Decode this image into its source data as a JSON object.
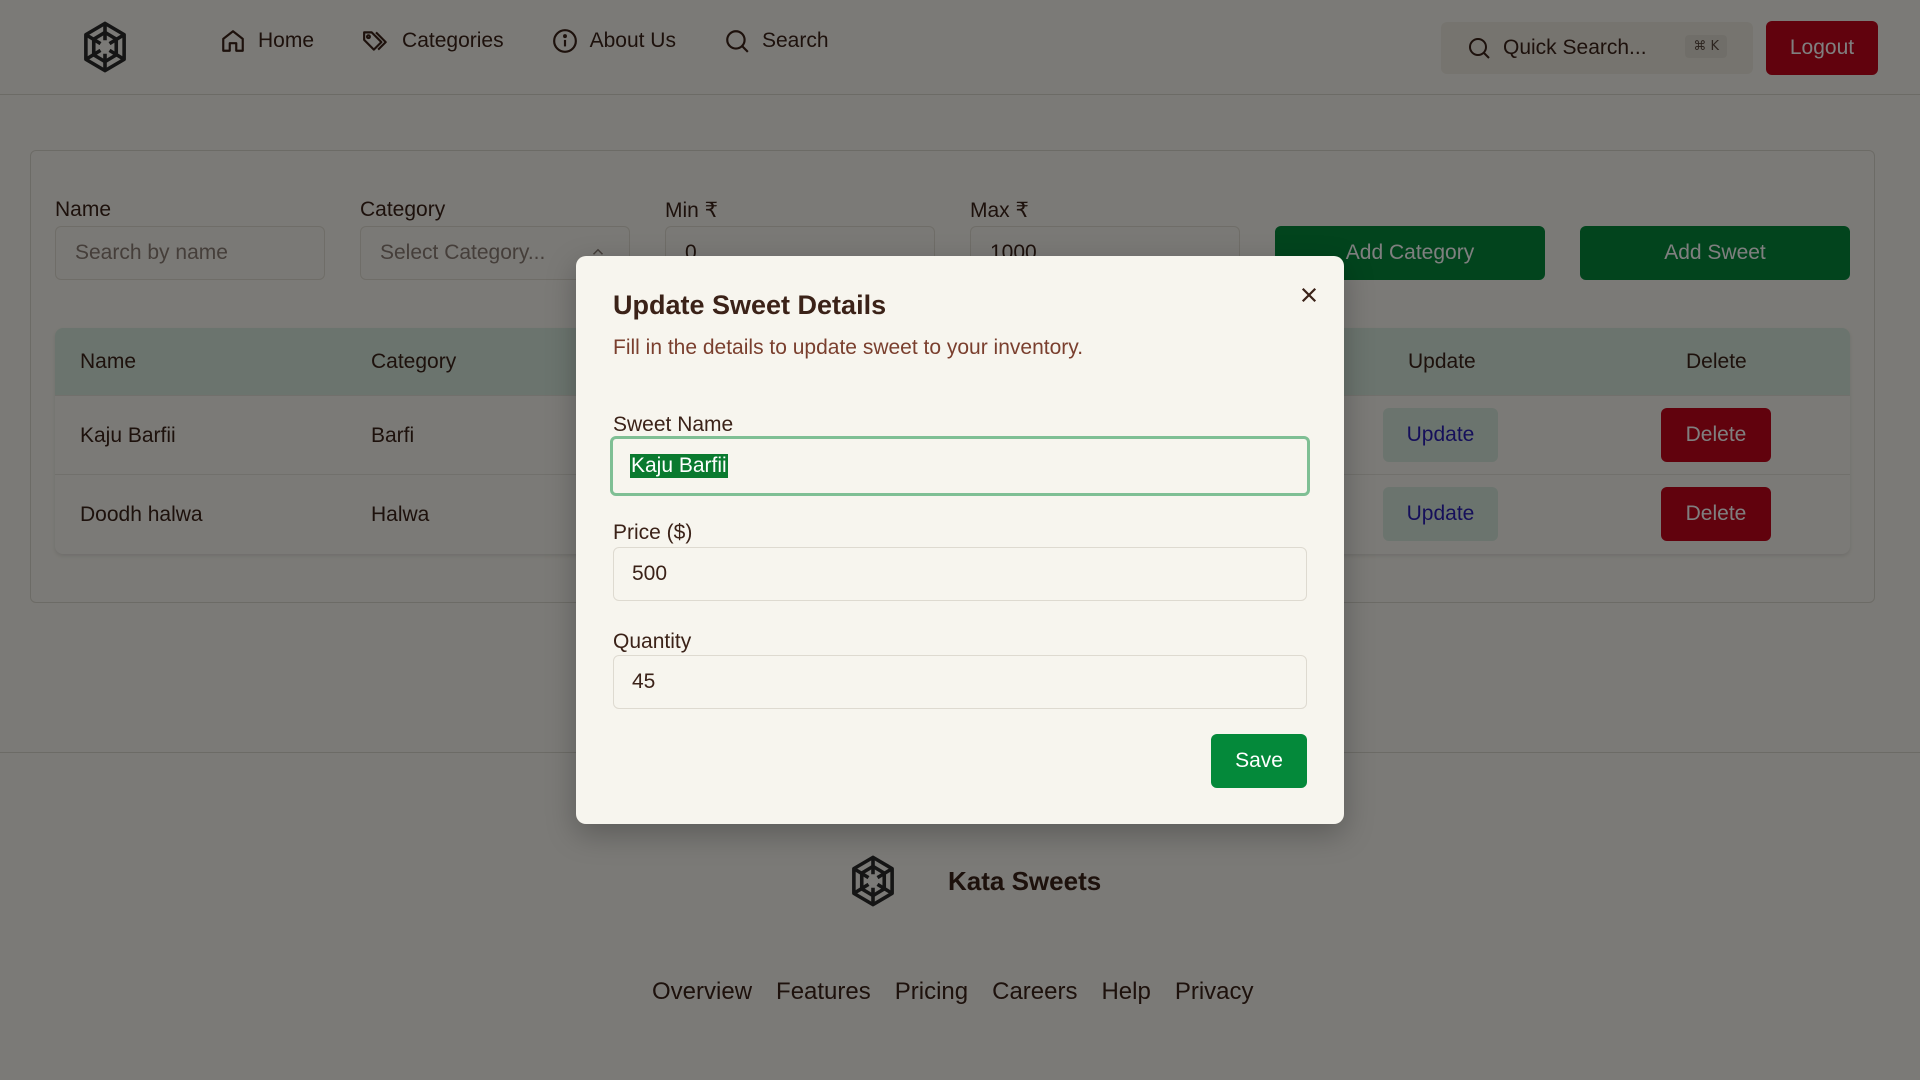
{
  "header": {
    "nav": [
      {
        "label": "Home",
        "icon": "home-icon"
      },
      {
        "label": "Categories",
        "icon": "tag-icon"
      },
      {
        "label": "About Us",
        "icon": "info-icon"
      },
      {
        "label": "Search",
        "icon": "search-icon"
      }
    ],
    "quick_search": "Quick Search...",
    "shortcut": "⌘ K",
    "logout": "Logout"
  },
  "filters": {
    "name_label": "Name",
    "name_placeholder": "Search by name",
    "category_label": "Category",
    "category_placeholder": "Select Category...",
    "min_label": "Min ₹",
    "min_value": "0",
    "max_label": "Max ₹",
    "max_value": "1000",
    "add_category": "Add Category",
    "add_sweet": "Add Sweet"
  },
  "table": {
    "columns": [
      "Name",
      "Category",
      "Update",
      "Delete"
    ],
    "rows": [
      {
        "name": "Kaju Barfii",
        "category": "Barfi",
        "update": "Update",
        "delete": "Delete"
      },
      {
        "name": "Doodh halwa",
        "category": "Halwa",
        "update": "Update",
        "delete": "Delete"
      }
    ]
  },
  "modal": {
    "title": "Update Sweet Details",
    "description": "Fill in the details to update sweet to your inventory.",
    "sweet_name_label": "Sweet Name",
    "sweet_name_value": "Kaju Barfii",
    "price_label": "Price ($)",
    "price_value": "500",
    "quantity_label": "Quantity",
    "quantity_value": "45",
    "save": "Save"
  },
  "footer": {
    "brand": "Kata Sweets",
    "links": [
      "Overview",
      "Features",
      "Pricing",
      "Careers",
      "Help",
      "Privacy"
    ]
  },
  "colors": {
    "primary_green": "#04893a",
    "danger_red": "#c3041a",
    "background": "#f7f5ee",
    "text_brown": "#3b2218"
  }
}
